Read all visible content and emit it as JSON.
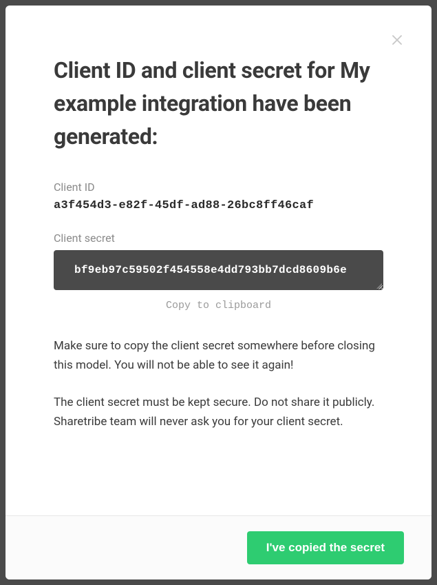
{
  "modal": {
    "title": "Client ID and client secret for My example integration have been generated:",
    "client_id": {
      "label": "Client ID",
      "value": "a3f454d3-e82f-45df-ad88-26bc8ff46caf"
    },
    "client_secret": {
      "label": "Client secret",
      "value": "bf9eb97c59502f454558e4dd793bb7dcd8609b6e",
      "copy_label": "Copy to clipboard"
    },
    "warning1": "Make sure to copy the client secret somewhere before closing this model. You will not be able to see it again!",
    "warning2": "The client secret must be kept secure. Do not share it publicly. Sharetribe team will never ask you for your client secret.",
    "confirm_button": "I've copied the secret"
  }
}
